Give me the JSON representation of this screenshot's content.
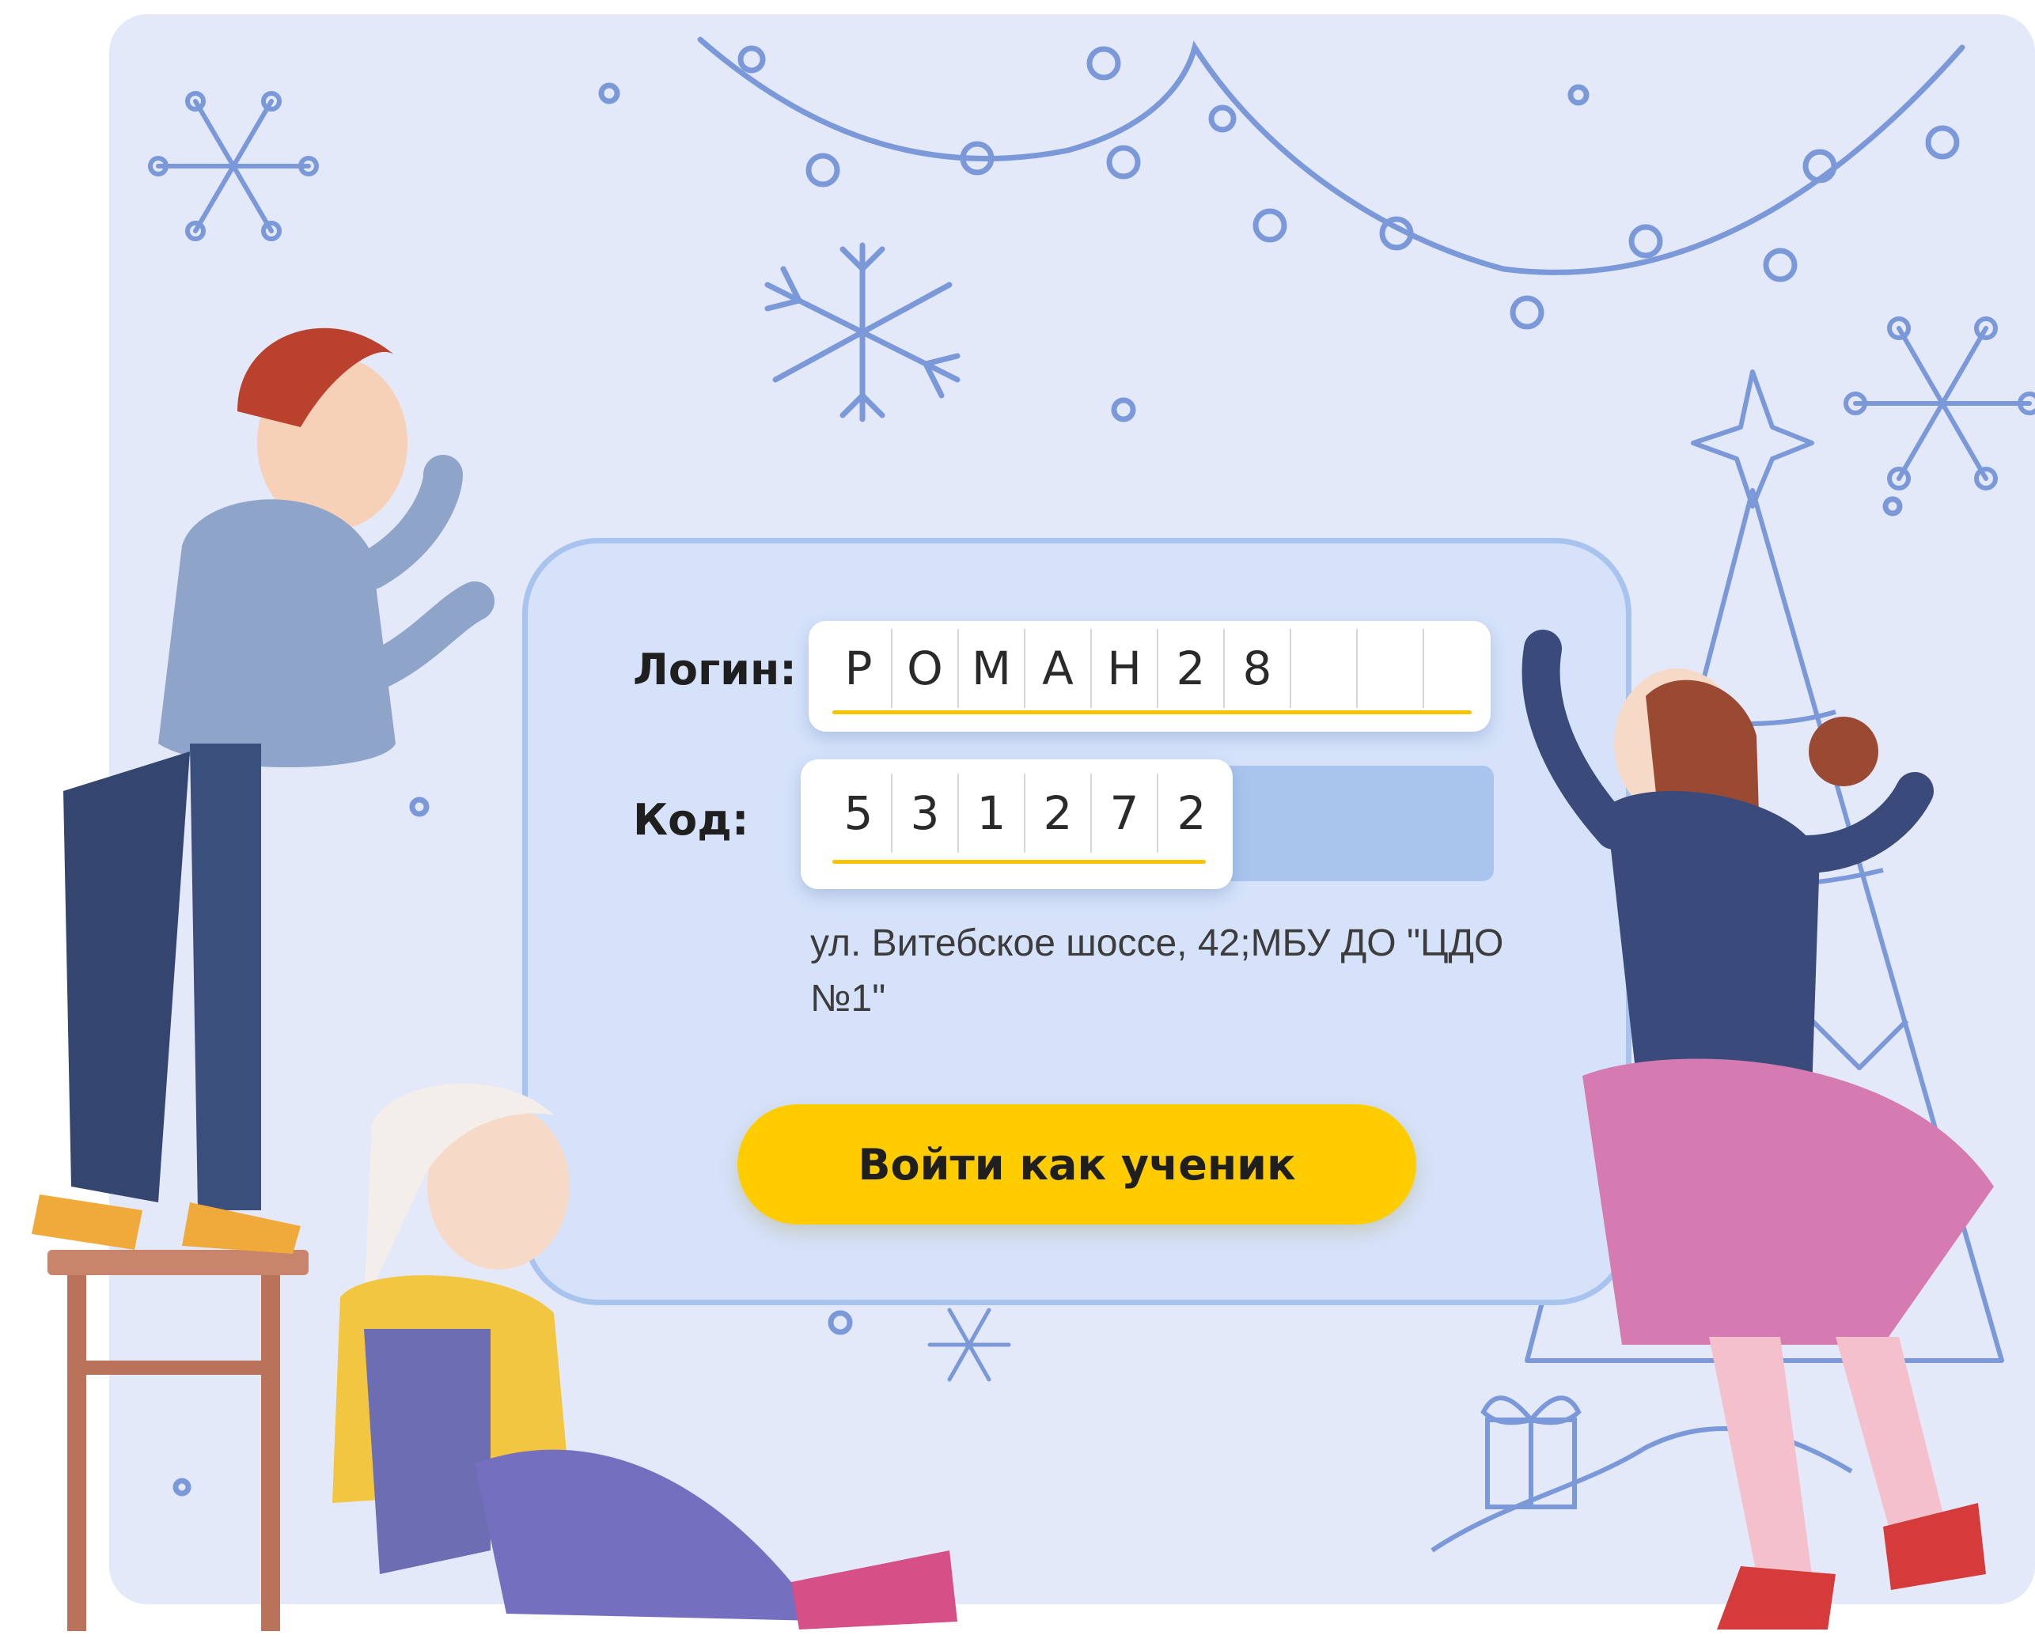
{
  "form": {
    "login_label": "Логин:",
    "code_label": "Код:",
    "login_chars": [
      "Р",
      "О",
      "М",
      "А",
      "Н",
      "2",
      "8",
      "",
      "",
      ""
    ],
    "code_chars": [
      "5",
      "3",
      "1",
      "2",
      "7",
      "2"
    ],
    "address_line1": "ул. Витебское шоссе, 42;МБУ ДО \"ЦДО",
    "address_line2": "№1\"",
    "submit_label": "Войти как ученик"
  },
  "colors": {
    "background": "#e3e9f9",
    "panel": "#d5e2fa",
    "accent_yellow": "#ffcc00",
    "sketch_blue": "#7b98d8"
  },
  "illustration": {
    "elements": [
      "snowflake-icon",
      "garland-icon",
      "christmas-tree-icon",
      "gift-icon",
      "boy-figure",
      "girl-sitting-figure",
      "girl-standing-figure",
      "stool-icon"
    ]
  }
}
